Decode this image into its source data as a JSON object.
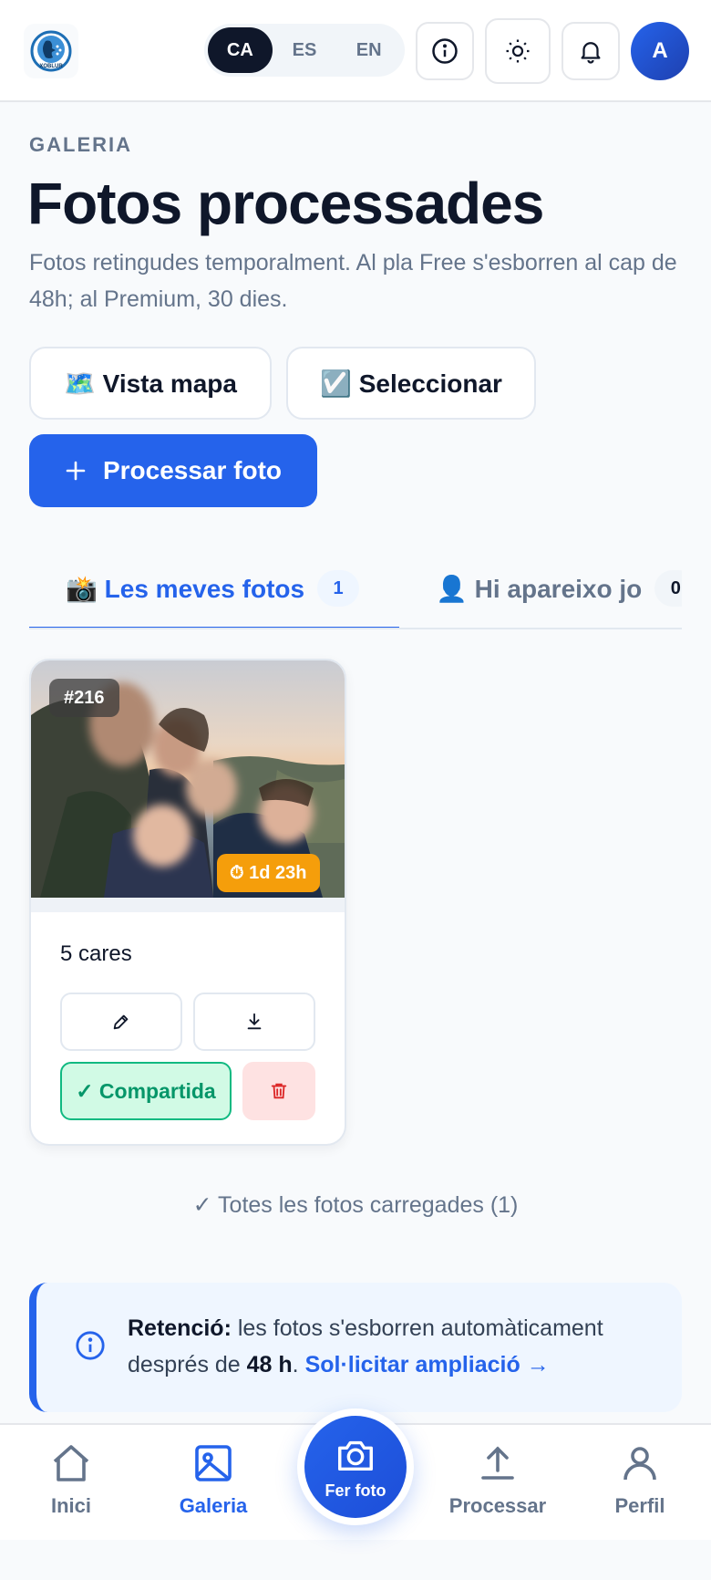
{
  "header": {
    "languages": [
      {
        "code": "CA",
        "active": true
      },
      {
        "code": "ES",
        "active": false
      },
      {
        "code": "EN",
        "active": false
      }
    ],
    "avatar_initial": "A",
    "logo_icon": "face-blur-logo-icon"
  },
  "page": {
    "eyebrow": "GALERIA",
    "title": "Fotos processades",
    "subtitle": "Fotos retingudes temporalment. Al pla Free s'esborren al cap de 48h; al Premium, 30 dies."
  },
  "actions": {
    "map_view": "🗺️ Vista mapa",
    "select": "☑️ Seleccionar",
    "process_photo": "Processar foto"
  },
  "tabs": [
    {
      "label": "📸 Les meves fotos",
      "count": "1",
      "active": true
    },
    {
      "label": "👤 Hi apareixo jo",
      "count": "0",
      "active": false
    }
  ],
  "photos": [
    {
      "id": "#216",
      "expires": "⏱ 1d 23h",
      "faces": "5 cares",
      "shared_label": "✓ Compartida"
    }
  ],
  "gallery_footer": "✓ Totes les fotos carregades (1)",
  "info_box": {
    "strong": "Retenció:",
    "text_before": " les fotos s'esborren automàticament després de ",
    "hours": "48 h",
    "text_after": ". ",
    "link": "Sol·licitar ampliació →"
  },
  "bottom_nav": {
    "home": "Inici",
    "gallery": "Galeria",
    "take_photo": "Fer foto",
    "process": "Processar",
    "profile": "Perfil",
    "active": "gallery"
  },
  "colors": {
    "accent": "#2563eb",
    "warning": "#f59e0b",
    "success": "#10b981",
    "danger_bg": "#fee2e2"
  }
}
